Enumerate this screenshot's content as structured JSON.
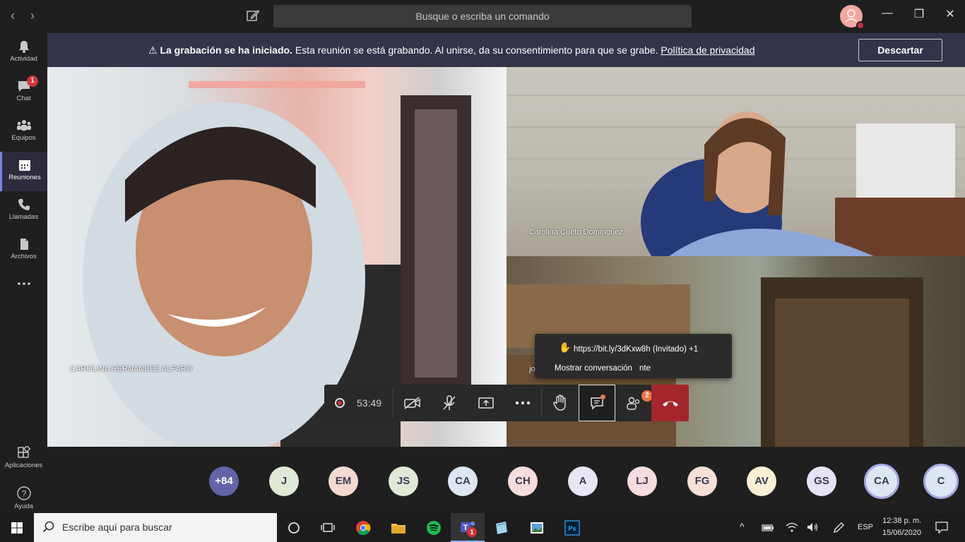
{
  "titlebar": {
    "search_placeholder": "Busque o escriba un comando"
  },
  "rail": {
    "items": [
      {
        "label": "Actividad"
      },
      {
        "label": "Chat",
        "badge": "1"
      },
      {
        "label": "Equipos"
      },
      {
        "label": "Reuniones"
      },
      {
        "label": "Llamadas"
      },
      {
        "label": "Archivos"
      },
      {
        "label": "Aplicaciones"
      },
      {
        "label": "Ayuda"
      }
    ]
  },
  "banner": {
    "bold": "La grabación se ha iniciado.",
    "message": " Esta reunión se está grabando. Al unirse, da su consentimiento para que se grabe. ",
    "link": "Política de privacidad",
    "dismiss_label": "Descartar"
  },
  "videos": [
    {
      "name": "CAROLINA HERNANDEZ ALFARO"
    },
    {
      "name": "Carolina Cueto Domínguez"
    },
    {
      "name": "jo"
    }
  ],
  "callbar": {
    "timer": "53:49",
    "participants_badge": "2"
  },
  "tooltip": {
    "raised_hand": "https://bit.ly/3dKxw8h (Invitado) +1",
    "chat_hint": "Mostrar conversación",
    "trailing": "nte"
  },
  "participants": [
    {
      "initials": "+84",
      "bg": "#6264a7",
      "fg": "#ffffff"
    },
    {
      "initials": "J",
      "bg": "#dfe9d6"
    },
    {
      "initials": "EM",
      "bg": "#f4d9d0"
    },
    {
      "initials": "JS",
      "bg": "#dfe9d6"
    },
    {
      "initials": "CA",
      "bg": "#dde6f3"
    },
    {
      "initials": "CH",
      "bg": "#f6dcdc"
    },
    {
      "initials": "A",
      "bg": "#e9e5f5"
    },
    {
      "initials": "LJ",
      "bg": "#f6dcdc"
    },
    {
      "initials": "FG",
      "bg": "#f9e0d6"
    },
    {
      "initials": "AV",
      "bg": "#fbefd8"
    },
    {
      "initials": "GS",
      "bg": "#e4e4f5"
    },
    {
      "initials": "CA",
      "bg": "#dde6f3",
      "ring": true
    },
    {
      "initials": "C",
      "bg": "#dde6f3",
      "ring": true
    }
  ],
  "taskbar": {
    "search_placeholder": "Escribe aquí para buscar",
    "teams_badge": "1",
    "language": "ESP",
    "time": "12:38 p. m.",
    "date": "15/06/2020"
  },
  "colors": {
    "accent": "#6264a7",
    "banner_bg": "#33344a",
    "hangup": "#a4262c"
  }
}
